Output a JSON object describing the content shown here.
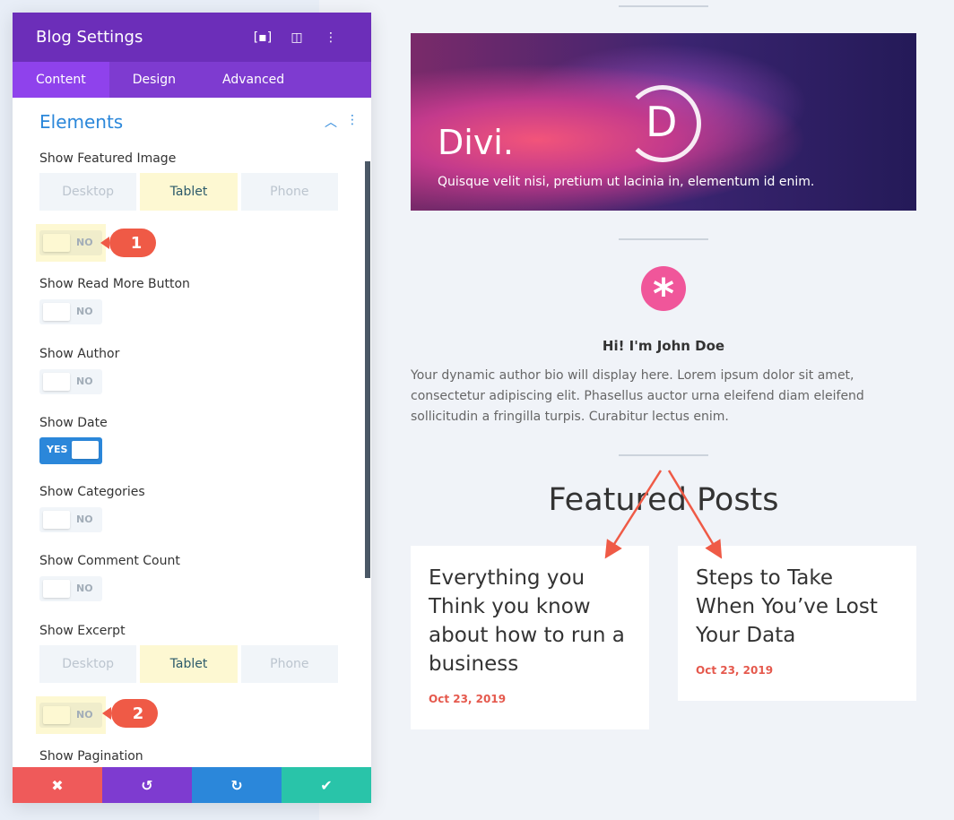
{
  "panel": {
    "title": "Blog Settings",
    "tabs": [
      "Content",
      "Design",
      "Advanced"
    ],
    "section": "Elements",
    "devices": [
      "Desktop",
      "Tablet",
      "Phone"
    ],
    "settings": [
      {
        "label": "Show Featured Image",
        "value": "NO"
      },
      {
        "label": "Show Read More Button",
        "value": "NO"
      },
      {
        "label": "Show Author",
        "value": "NO"
      },
      {
        "label": "Show Date",
        "value": "YES"
      },
      {
        "label": "Show Categories",
        "value": "NO"
      },
      {
        "label": "Show Comment Count",
        "value": "NO"
      },
      {
        "label": "Show Excerpt",
        "value": "NO"
      },
      {
        "label": "Show Pagination"
      }
    ],
    "badges": [
      "1",
      "2"
    ],
    "footer_colors": [
      "#ef5a5a",
      "#7e3bd0",
      "#2b87da",
      "#29c4a9"
    ]
  },
  "preview": {
    "hero": {
      "logo": "D",
      "title": "Divi.",
      "subtitle": "Quisque velit nisi, pretium ut lacinia in, elementum id enim."
    },
    "author": {
      "name": "Hi! I'm John Doe",
      "bio": "Your dynamic author bio will display here. Lorem ipsum dolor sit amet, consectetur adipiscing elit. Phasellus auctor urna eleifend diam eleifend sollicitudin a fringilla turpis. Curabitur lectus enim."
    },
    "featured_heading": "Featured Posts",
    "posts": [
      {
        "title": "Everything you Think you know about how to run a business",
        "date": "Oct 23, 2019"
      },
      {
        "title": "Steps to Take When You’ve Lost Your Data",
        "date": "Oct 23, 2019"
      }
    ]
  }
}
